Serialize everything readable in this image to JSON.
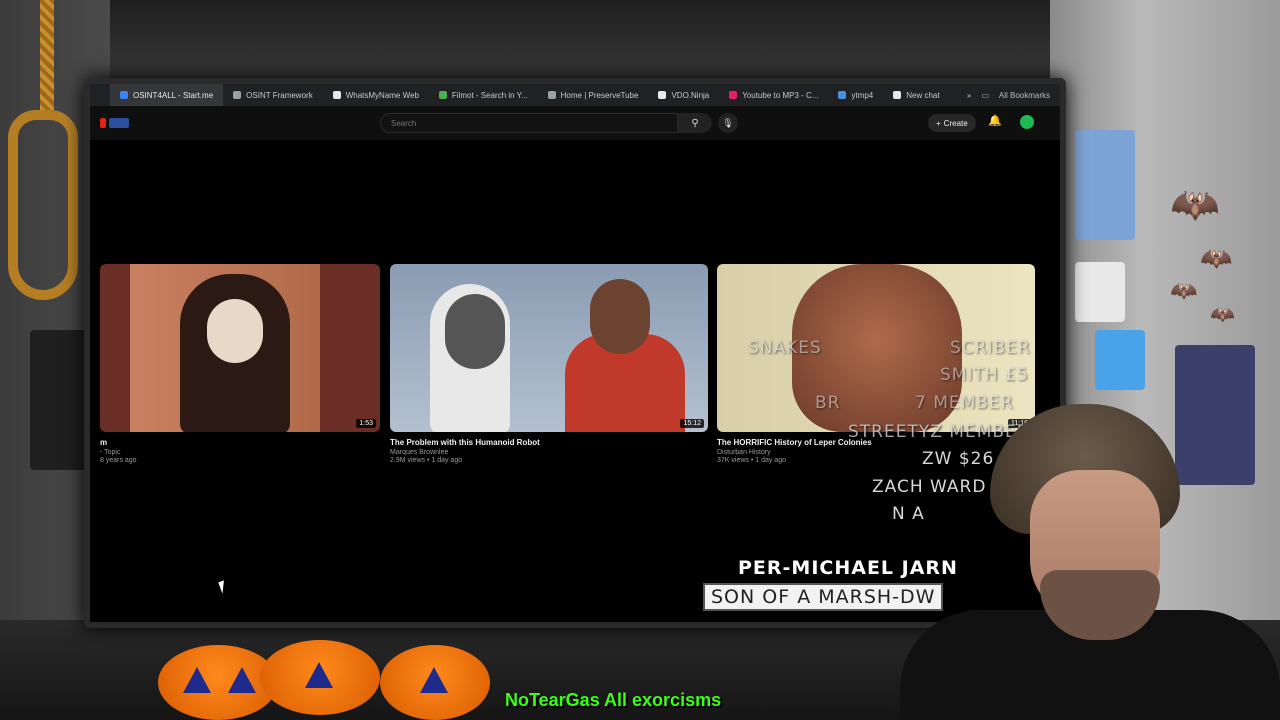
{
  "browser": {
    "tabs": [
      {
        "label": "OSINT4ALL - Start.me",
        "color": "#3b82f6",
        "active": true
      },
      {
        "label": "OSINT Framework",
        "color": "#9aa0a6"
      },
      {
        "label": "WhatsMyName Web",
        "color": "#e8e8e8"
      },
      {
        "label": "Filmot - Search in Y...",
        "color": "#4caf50"
      },
      {
        "label": "Home | PreserveTube",
        "color": "#9aa0a6"
      },
      {
        "label": "VDO.Ninja",
        "color": "#e8e8e8"
      },
      {
        "label": "Youtube to MP3 - C...",
        "color": "#e91e63"
      },
      {
        "label": "ytmp4",
        "color": "#4a90e2"
      },
      {
        "label": "New chat",
        "color": "#e8e8e8"
      }
    ],
    "overflow": "»",
    "bookmarks_label": "All Bookmarks"
  },
  "youtube": {
    "search_placeholder": "Search",
    "search_icon": "search-icon",
    "mic_icon": "mic-icon",
    "create_label": "Create",
    "bell_icon": "bell-icon"
  },
  "videos": [
    {
      "title": "m",
      "channel": "- Topic",
      "meta": "8 years ago",
      "duration": "1:53"
    },
    {
      "title": "The Problem with this Humanoid Robot",
      "channel": "Marques Brownlee",
      "meta": "2.9M views • 1 day ago",
      "duration": "15:12"
    },
    {
      "title": "The HORRIFIC History of Leper Colonies",
      "channel": "Disturban History",
      "meta": "37K views • 1 day ago",
      "duration": "11:16"
    }
  ],
  "overlay": {
    "lines": [
      "SNAKES",
      "SCRIBER",
      "SMITH £5",
      "BR",
      "7 MEMBER",
      "STREETYZ MEMBER X6",
      "ZW $26",
      "ZACH WARD",
      "N A"
    ],
    "name_line": "PER-MICHAEL JARN",
    "son_line": "SON OF A MARSH-DW",
    "ticker": "NoTearGas  All exorcisms"
  },
  "colors": {
    "yt_bg": "#0f0f0f",
    "tab_bar": "#202124",
    "ticker": "#39ff14"
  }
}
